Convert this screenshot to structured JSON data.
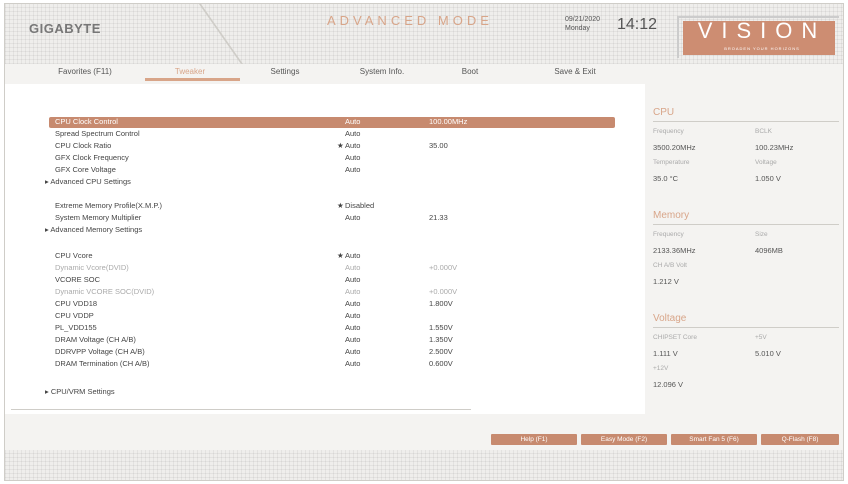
{
  "header": {
    "logo": "GIGABYTE",
    "mode_title": "ADVANCED MODE",
    "date": "09/21/2020",
    "weekday": "Monday",
    "time": "14:12",
    "vision_word": "VISION",
    "vision_sub": "BROADEN YOUR HORIZONS"
  },
  "tabs": [
    {
      "label": "Favorites (F11)"
    },
    {
      "label": "Tweaker"
    },
    {
      "label": "Settings"
    },
    {
      "label": "System Info."
    },
    {
      "label": "Boot"
    },
    {
      "label": "Save & Exit"
    }
  ],
  "settings": [
    {
      "label": "CPU Clock Control",
      "star": "",
      "value": "Auto",
      "value2": "100.00MHz"
    },
    {
      "label": "Spread Spectrum Control",
      "star": "",
      "value": "Auto",
      "value2": ""
    },
    {
      "label": "CPU Clock Ratio",
      "star": "★",
      "value": "Auto",
      "value2": "35.00"
    },
    {
      "label": "GFX Clock Frequency",
      "star": "",
      "value": "Auto",
      "value2": ""
    },
    {
      "label": "GFX Core Voltage",
      "star": "",
      "value": "Auto",
      "value2": ""
    },
    {
      "label": "▸ Advanced CPU Settings",
      "star": "",
      "value": "",
      "value2": ""
    },
    {
      "label": "Extreme Memory Profile(X.M.P.)",
      "star": "★",
      "value": "Disabled",
      "value2": ""
    },
    {
      "label": "System Memory Multiplier",
      "star": "",
      "value": "Auto",
      "value2": "21.33"
    },
    {
      "label": "▸ Advanced Memory Settings",
      "star": "",
      "value": "",
      "value2": ""
    },
    {
      "label": "CPU Vcore",
      "star": "★",
      "value": "Auto",
      "value2": ""
    },
    {
      "label": "Dynamic Vcore(DVID)",
      "star": "",
      "value": "Auto",
      "value2": "+0.000V"
    },
    {
      "label": "VCORE SOC",
      "star": "",
      "value": "Auto",
      "value2": ""
    },
    {
      "label": "Dynamic VCORE SOC(DVID)",
      "star": "",
      "value": "Auto",
      "value2": "+0.000V"
    },
    {
      "label": "CPU VDD18",
      "star": "",
      "value": "Auto",
      "value2": "1.800V"
    },
    {
      "label": "CPU VDDP",
      "star": "",
      "value": "Auto",
      "value2": ""
    },
    {
      "label": "PL_VDD155",
      "star": "",
      "value": "Auto",
      "value2": "1.550V"
    },
    {
      "label": "DRAM Voltage (CH A/B)",
      "star": "",
      "value": "Auto",
      "value2": "1.350V"
    },
    {
      "label": "DDRVPP Voltage (CH A/B)",
      "star": "",
      "value": "Auto",
      "value2": "2.500V"
    },
    {
      "label": "DRAM Termination (CH A/B)",
      "star": "",
      "value": "Auto",
      "value2": "0.600V"
    },
    {
      "label": "▸ CPU/VRM Settings",
      "star": "",
      "value": "",
      "value2": ""
    }
  ],
  "cpu": {
    "title": "CPU",
    "freq_label": "Frequency",
    "bclk_label": "BCLK",
    "freq_value": "3500.20MHz",
    "bclk_value": "100.23MHz",
    "temp_label": "Temperature",
    "volt_label": "Voltage",
    "temp_value": "35.0 °C",
    "volt_value": "1.050 V"
  },
  "memory": {
    "title": "Memory",
    "freq_label": "Frequency",
    "size_label": "Size",
    "freq_value": "2133.36MHz",
    "size_value": "4096MB",
    "volt_label": "CH A/B Volt",
    "volt_value": "1.212 V"
  },
  "voltage": {
    "title": "Voltage",
    "chipset_label": "CHIPSET Core",
    "p5_label": "+5V",
    "chipset_value": "1.111 V",
    "p5_value": "5.010 V",
    "p12_label": "+12V",
    "p12_value": "12.096 V"
  },
  "footer": {
    "help": "Help (F1)",
    "easy": "Easy Mode (F2)",
    "fan": "Smart Fan 5 (F6)",
    "qflash": "Q-Flash (F8)"
  }
}
